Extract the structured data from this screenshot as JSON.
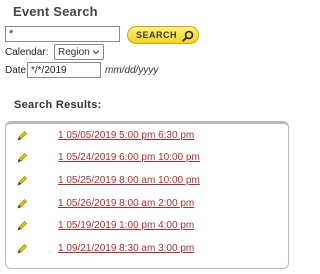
{
  "page": {
    "title": "Event Search"
  },
  "search": {
    "query_value": "*",
    "button_label": "SEARCH"
  },
  "filters": {
    "calendar_label": "Calendar:",
    "calendar_selected": "Region",
    "date_label": "Date:",
    "date_value": "*/*/2019",
    "date_format_hint": "mm/dd/yyyy"
  },
  "results": {
    "title": "Search Results:",
    "items": [
      {
        "label": "1 05/05/2019 5:00 pm 6:30 pm"
      },
      {
        "label": "1 05/24/2019 6:00 pm 10:00 pm"
      },
      {
        "label": "1 05/25/2019 8:00 am 10:00 pm"
      },
      {
        "label": "1 05/26/2019 8:00 am 2:00 pm"
      },
      {
        "label": "1 05/19/2019 1:00 pm 4:00 pm"
      },
      {
        "label": "1 09/21/2019 8:30 am 3:00 pm"
      }
    ]
  },
  "colors": {
    "button_yellow": "#f3d51e",
    "link_red": "#a43232",
    "pencil_yellow": "#e0c400"
  }
}
